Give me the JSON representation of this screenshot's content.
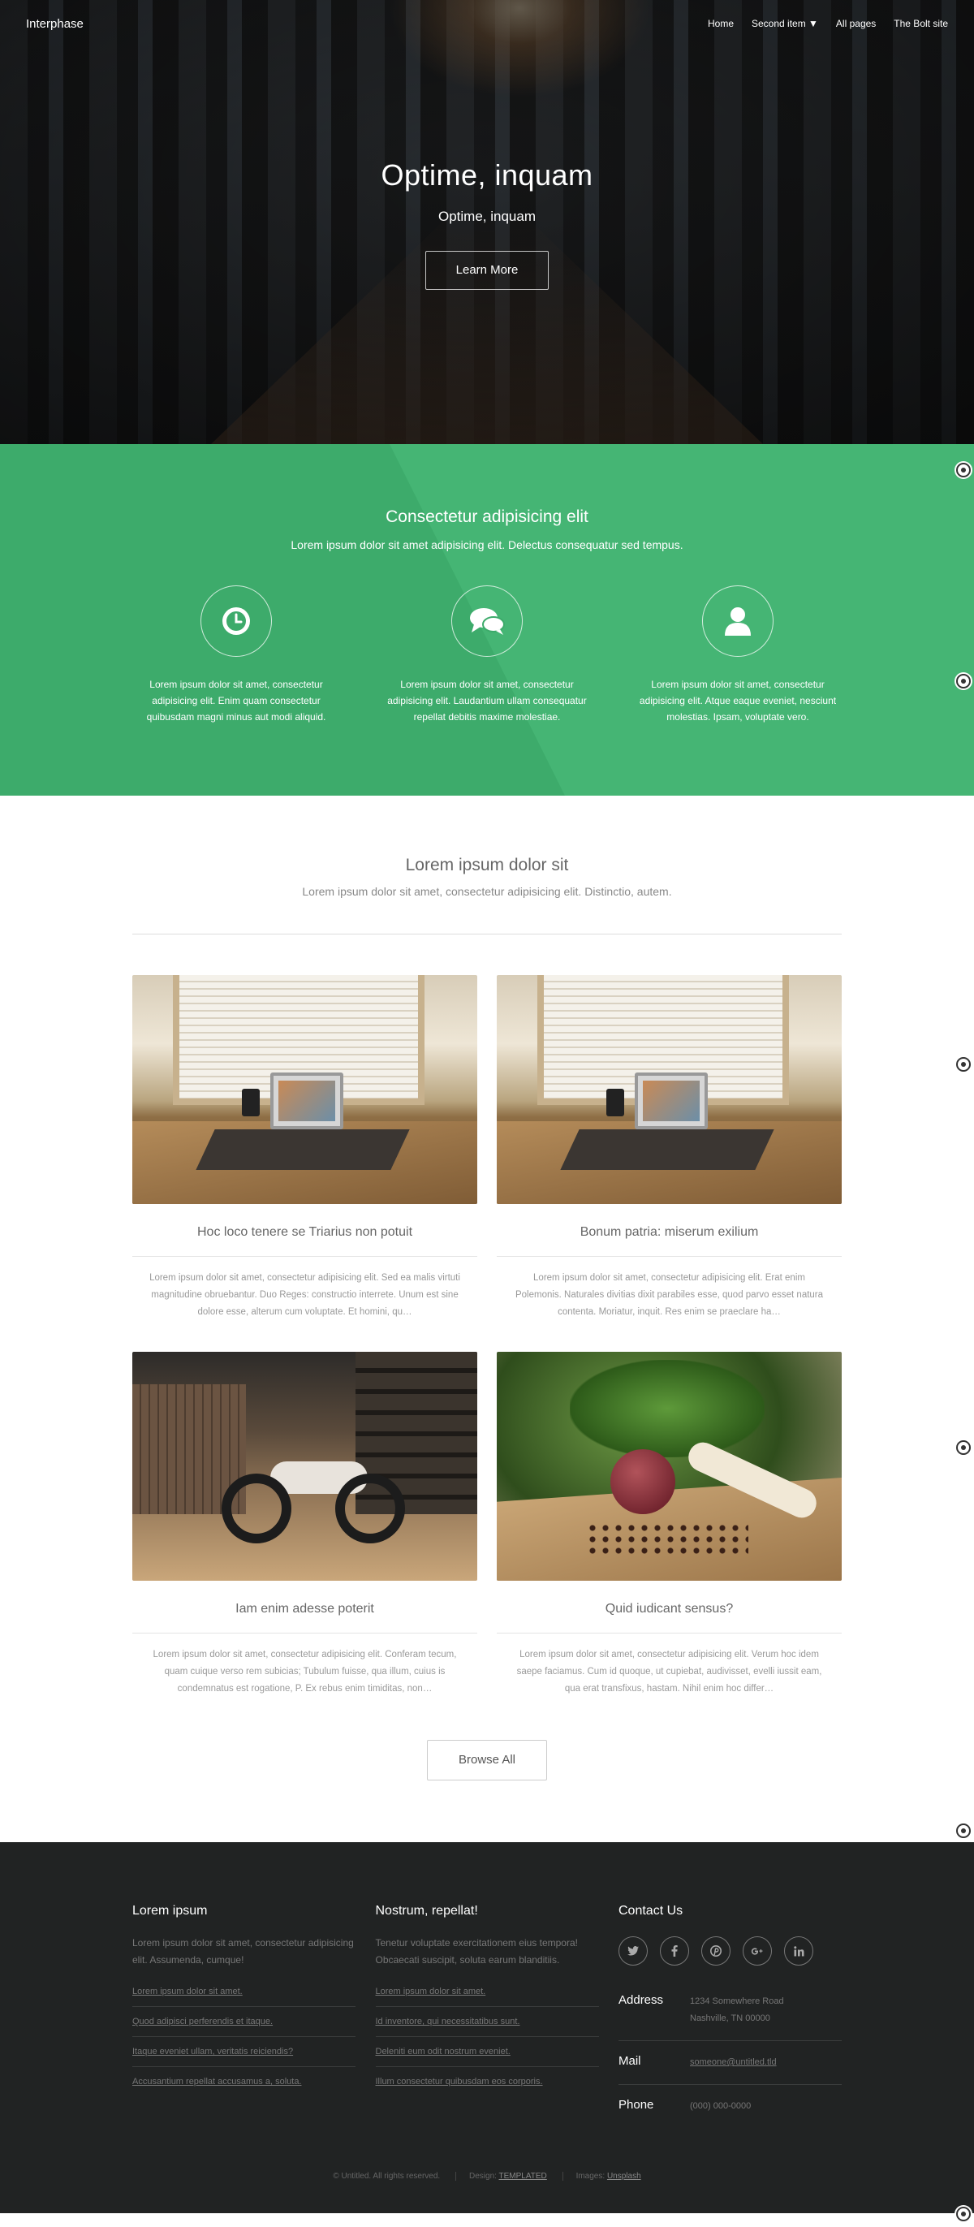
{
  "nav": {
    "logo": "Interphase",
    "items": [
      "Home",
      "Second item ▼",
      "All pages",
      "The Bolt site"
    ]
  },
  "banner": {
    "title": "Optime, inquam",
    "subtitle": "Optime, inquam",
    "button": "Learn More"
  },
  "features": {
    "title": "Consectetur adipisicing elit",
    "subtitle": "Lorem ipsum dolor sit amet adipisicing elit. Delectus consequatur sed tempus.",
    "items": [
      {
        "icon": "clock-icon",
        "text": "Lorem ipsum dolor sit amet, consectetur adipisicing elit. Enim quam consectetur quibusdam magni minus aut modi aliquid."
      },
      {
        "icon": "comments-icon",
        "text": "Lorem ipsum dolor sit amet, consectetur adipisicing elit. Laudantium ullam consequatur repellat debitis maxime molestiae."
      },
      {
        "icon": "user-icon",
        "text": "Lorem ipsum dolor sit amet, consectetur adipisicing elit. Atque eaque eveniet, nesciunt molestias. Ipsam, voluptate vero."
      }
    ]
  },
  "main": {
    "title": "Lorem ipsum dolor sit",
    "subtitle": "Lorem ipsum dolor sit amet, consectetur adipisicing elit. Distinctio, autem.",
    "posts": [
      {
        "image": "laptop-on-desk",
        "title": "Hoc loco tenere se Triarius non potuit",
        "text": "Lorem ipsum dolor sit amet, consectetur adipisicing elit. Sed ea malis virtuti magnitudine obruebantur. Duo Reges: constructio interrete. Unum est sine dolore esse, alterum cum voluptate. Et homini, qu…"
      },
      {
        "image": "laptop-on-desk",
        "title": "Bonum patria: miserum exilium",
        "text": "Lorem ipsum dolor sit amet, consectetur adipisicing elit. Erat enim Polemonis. Naturales divitias dixit parabiles esse, quod parvo esset natura contenta. Moriatur, inquit. Res enim se praeclare ha…"
      },
      {
        "image": "motorcycle-garage",
        "title": "Iam enim adesse poterit",
        "text": "Lorem ipsum dolor sit amet, consectetur adipisicing elit. Conferam tecum, quam cuique verso rem subicias; Tubulum fuisse, qua illum, cuius is condemnatus est rogatione, P. Ex rebus enim timiditas, non…"
      },
      {
        "image": "vegetables-board",
        "title": "Quid iudicant sensus?",
        "text": "Lorem ipsum dolor sit amet, consectetur adipisicing elit. Verum hoc idem saepe faciamus. Cum id quoque, ut cupiebat, audivisset, evelli iussit eam, qua erat transfixus, hastam. Nihil enim hoc differ…"
      }
    ],
    "browse": "Browse All"
  },
  "footer": {
    "col1": {
      "title": "Lorem ipsum",
      "desc": "Lorem ipsum dolor sit amet, consectetur adipisicing elit. Assumenda, cumque!",
      "links": [
        "Lorem ipsum dolor sit amet.",
        "Quod adipisci perferendis et itaque.",
        "Itaque eveniet ullam, veritatis reiciendis?",
        "Accusantium repellat accusamus a, soluta."
      ]
    },
    "col2": {
      "title": "Nostrum, repellat!",
      "desc": "Tenetur voluptate exercitationem eius tempora! Obcaecati suscipit, soluta earum blanditiis.",
      "links": [
        "Lorem ipsum dolor sit amet.",
        "Id inventore, qui necessitatibus sunt.",
        "Deleniti eum odit nostrum eveniet.",
        "Illum consectetur quibusdam eos corporis."
      ]
    },
    "col3": {
      "title": "Contact Us",
      "socials": [
        "twitter-icon",
        "facebook-icon",
        "pinterest-icon",
        "google-plus-icon",
        "linkedin-icon"
      ],
      "address_label": "Address",
      "address_line1": "1234 Somewhere Road",
      "address_line2": "Nashville, TN 00000",
      "mail_label": "Mail",
      "mail_value": "someone@untitled.tld",
      "phone_label": "Phone",
      "phone_value": "(000) 000-0000"
    },
    "copyright": "© Untitled. All rights reserved.",
    "design_label": "Design:",
    "design_link": "TEMPLATED",
    "images_label": "Images:",
    "images_link": "Unsplash"
  }
}
